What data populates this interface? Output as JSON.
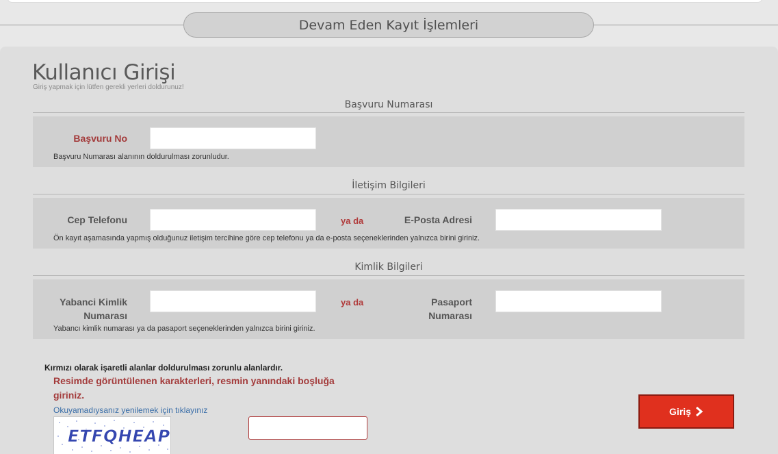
{
  "header": {
    "title": "Devam Eden Kayıt İşlemleri"
  },
  "page": {
    "title": "Kullanıcı Girişi",
    "subtitle": "Giriş yapmak için lütfen gerekli yerleri doldurunuz!"
  },
  "application": {
    "section_title": "Başvuru Numarası",
    "label": "Başvuru No",
    "value": "",
    "hint": "Başvuru Numarası alanının doldurulması zorunludur."
  },
  "contact": {
    "section_title": "İletişim Bilgileri",
    "phone_label": "Cep Telefonu",
    "phone_value": "",
    "or_label": "ya da",
    "email_label": "E-Posta Adresi",
    "email_value": "",
    "hint": "Ön kayıt aşamasında yapmış olduğunuz iletişim tercihine göre cep telefonu ya da e-posta seçeneklerinden yalnızca birini giriniz."
  },
  "identity": {
    "section_title": "Kimlik Bilgileri",
    "foreign_id_label_line1": "Yabanci Kimlik",
    "foreign_id_label_line2": "Numarası",
    "foreign_id_value": "",
    "or_label": "ya da",
    "passport_label_line1": "Pasaport",
    "passport_label_line2": "Numarası",
    "passport_value": "",
    "hint": "Yabancı kimlik numarası ya da pasaport seçeneklerinden yalnızca birini giriniz."
  },
  "form": {
    "required_note": "Kırmızı olarak işaretli alanlar doldurulması zorunlu alanlardır.",
    "captcha_message": "Resimde görüntülenen karakterleri, resmin yanındaki boşluğa giriniz.",
    "refresh_link": "Okuyamadıysanız yenilemek için tıklayınız",
    "captcha_text": "ETFQHEAP",
    "captcha_value": "",
    "submit_label": "Giriş"
  },
  "colors": {
    "accent": "#e0301e",
    "required_label": "#a33a3a",
    "link": "#3a6ea8"
  }
}
